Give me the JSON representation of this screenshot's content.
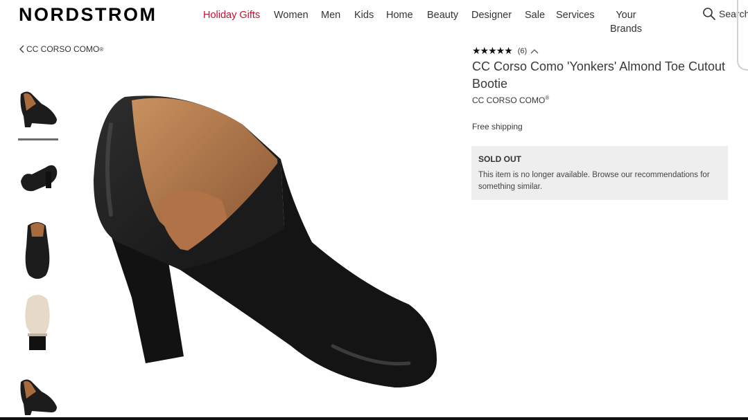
{
  "header": {
    "logo": "NORDSTROM",
    "nav": [
      {
        "label": "Holiday Gifts",
        "color": "#c8102e"
      },
      {
        "label": "Women"
      },
      {
        "label": "Men"
      },
      {
        "label": "Kids"
      },
      {
        "label": "Home"
      },
      {
        "label": "Beauty"
      },
      {
        "label": "Designer"
      },
      {
        "label": "Sale"
      },
      {
        "label": "Services"
      }
    ],
    "your_brands": {
      "line1": "Your",
      "line2": "Brands"
    },
    "search_label": "Search",
    "search_icon": "magnifier-icon"
  },
  "breadcrumb": {
    "label": "CC CORSO COMO",
    "reg": "®",
    "icon": "chevron-left-icon"
  },
  "product": {
    "stars": "★★★★★",
    "review_count": "(6)",
    "title": "CC Corso Como 'Yonkers' Almond Toe Cutout Bootie",
    "brand": "CC CORSO COMO",
    "brand_reg": "®",
    "shipping": "Free shipping",
    "status_title": "SOLD OUT",
    "status_text": "This item is no longer available. Browse our recommendations for something similar."
  },
  "gallery": {
    "selected_index": 0,
    "thumbnails": [
      "side-view",
      "back-view",
      "front-view",
      "sole-view",
      "angle-view"
    ]
  },
  "colors": {
    "accent": "#c8102e",
    "status_bg": "#eeeeee",
    "leather": "#1a1a1a",
    "lining": "#b47a4a"
  }
}
